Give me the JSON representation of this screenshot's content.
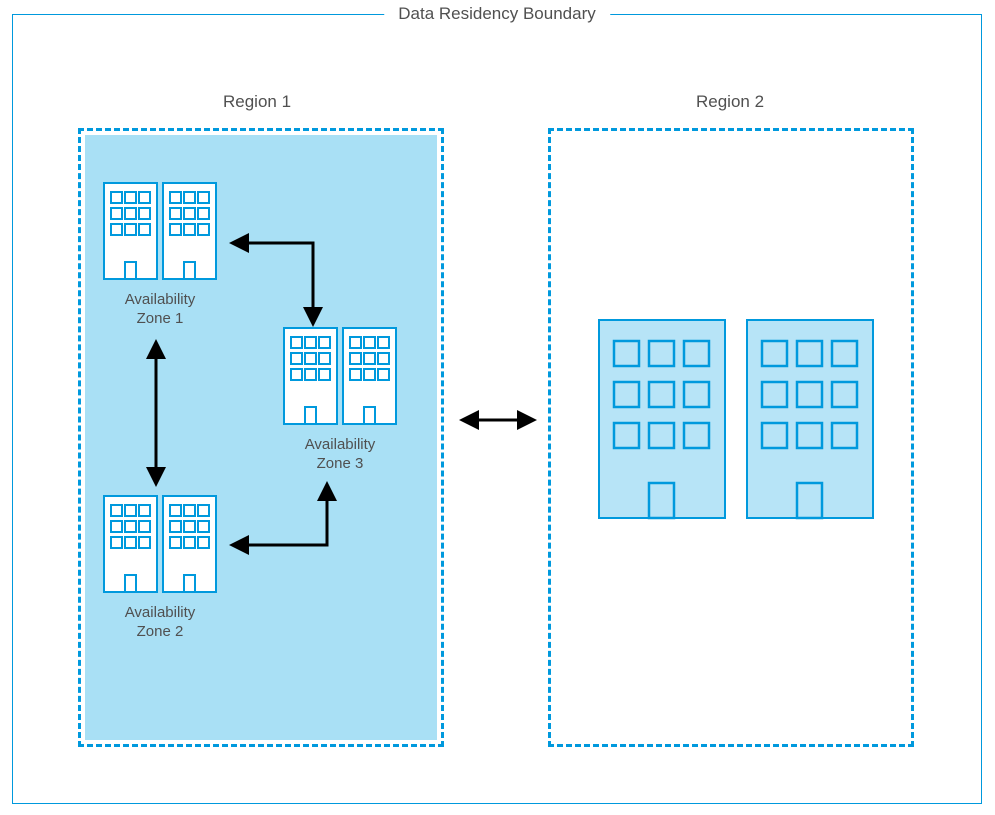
{
  "boundary": {
    "label": "Data Residency Boundary"
  },
  "region1": {
    "label": "Region 1",
    "zones": [
      {
        "label_l1": "Availability",
        "label_l2": "Zone 1"
      },
      {
        "label_l1": "Availability",
        "label_l2": "Zone 2"
      },
      {
        "label_l1": "Availability",
        "label_l2": "Zone 3"
      }
    ]
  },
  "region2": {
    "label": "Region 2"
  },
  "colors": {
    "border": "#0099dd",
    "zone_fill": "#A9E0F5",
    "building_fill": "#ffffff",
    "large_building_fill": "#b7e4f7",
    "arrow": "#000000",
    "text": "#505050"
  }
}
